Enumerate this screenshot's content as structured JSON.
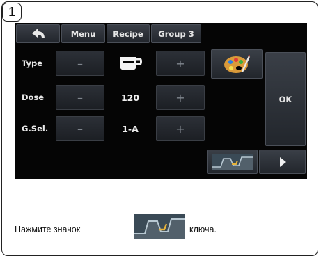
{
  "step_number": "1",
  "toolbar": {
    "menu_label": "Menu",
    "recipe_label": "Recipe",
    "group_label": "Group 3"
  },
  "rows": [
    {
      "label": "Type",
      "value_icon": "coffee-cup-icon",
      "minus": "–",
      "plus": "+"
    },
    {
      "label": "Dose",
      "value": "120",
      "minus": "–",
      "plus": "+"
    },
    {
      "label": "G.Sel.",
      "value": "1-A",
      "minus": "–",
      "plus": "+"
    }
  ],
  "ok_label": "OK",
  "instruction": {
    "prefix": "Нажмите значок",
    "suffix": "ключа.",
    "icon": "key-curve-icon"
  },
  "colors": {
    "screen_bg": "#050505",
    "button_top": "#3a3f47",
    "button_bottom": "#22262c",
    "text": "#e6e6e6"
  }
}
